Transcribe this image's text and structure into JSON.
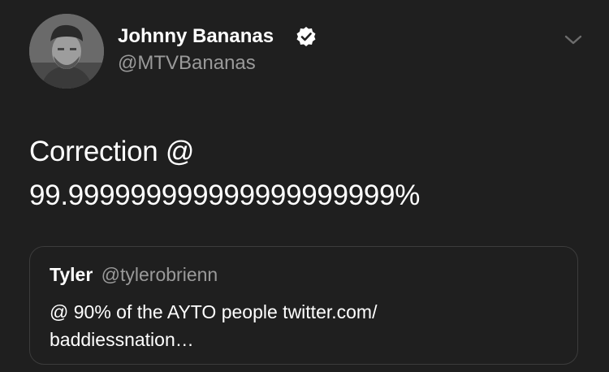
{
  "author": {
    "display_name": "Johnny Bananas",
    "handle": "@MTVBananas",
    "verified_icon": "verified-badge-icon",
    "avatar_icon": "profile-photo"
  },
  "menu": {
    "icon": "chevron-down-icon"
  },
  "tweet": {
    "lines": [
      "Correction @",
      "99.999999999999999999999%"
    ]
  },
  "quoted_tweet": {
    "name": "Tyler",
    "handle": "@tylerobrienn",
    "lines": [
      "@ 90% of the AYTO people twitter.com/",
      "baddiessnation…"
    ]
  },
  "colors": {
    "background": "#1f1f1f",
    "text_primary": "#ffffff",
    "text_secondary": "#9a9a9a",
    "border": "#3c3c3c"
  }
}
